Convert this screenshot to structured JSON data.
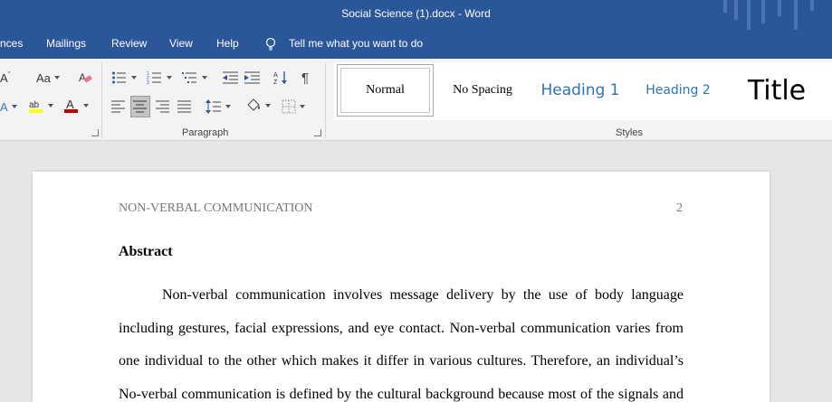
{
  "window": {
    "title": "Social Science (1).docx  -  Word"
  },
  "menu": {
    "items": [
      "nces",
      "Mailings",
      "Review",
      "View",
      "Help"
    ],
    "tell_me": "Tell me what you want to do"
  },
  "ribbon": {
    "font_group": {
      "change_case_label": "Aa"
    },
    "paragraph_label": "Paragraph",
    "styles_label": "Styles",
    "styles": [
      "Normal",
      "No Spacing",
      "Heading 1",
      "Heading 2",
      "Title"
    ],
    "selected_style": "Normal"
  },
  "document": {
    "header_left": "NON-VERBAL COMMUNICATION",
    "page_number": "2",
    "heading": "Abstract",
    "lines": [
      "Non-verbal communication involves message delivery by the use of body language",
      "including gestures, facial expressions, and eye contact. Non-verbal communication varies from",
      "one individual to the other which makes it differ in various cultures. Therefore, an individual’s",
      "No-verbal communication is defined by the cultural background because most of the signals and"
    ]
  },
  "colors": {
    "titlebar": "#2b579a",
    "highlight": "#ffff00",
    "font_color": "#c00000",
    "heading_style": "#2e74b5"
  }
}
